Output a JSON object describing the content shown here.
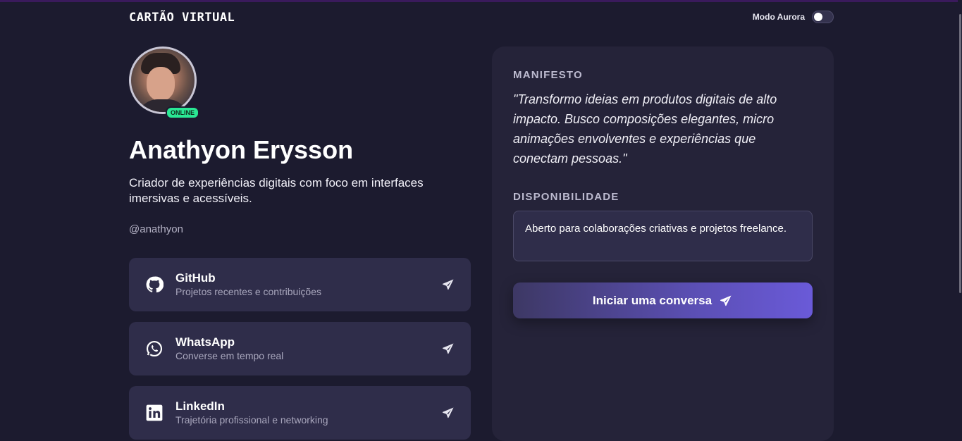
{
  "header": {
    "brand": "CARTÃO VIRTUAL",
    "mode_label": "Modo Aurora",
    "mode_enabled": false
  },
  "profile": {
    "status_badge": "ONLINE",
    "name": "Anathyon Erysson",
    "tagline": "Criador de experiências digitais com foco em interfaces imersivas e acessíveis.",
    "handle": "@anathyon"
  },
  "links": [
    {
      "icon": "github-icon",
      "title": "GitHub",
      "subtitle": "Projetos recentes e contribuições"
    },
    {
      "icon": "whatsapp-icon",
      "title": "WhatsApp",
      "subtitle": "Converse em tempo real"
    },
    {
      "icon": "linkedin-icon",
      "title": "LinkedIn",
      "subtitle": "Trajetória profissional e networking"
    }
  ],
  "panel": {
    "manifesto_title": "MANIFESTO",
    "manifesto_text": "\"Transformo ideias em produtos digitais de alto impacto. Busco composições elegantes, micro animações envolventes e experiências que conectam pessoas.\"",
    "availability_title": "DISPONIBILIDADE",
    "availability_text": "Aberto para colaborações criativas e projetos freelance.",
    "cta_label": "Iniciar uma conversa"
  },
  "colors": {
    "background": "#1c1b2f",
    "card": "#2f2d4a",
    "panel": "#252339",
    "online": "#2ae894",
    "cta_accent": "#6a5ad8"
  }
}
